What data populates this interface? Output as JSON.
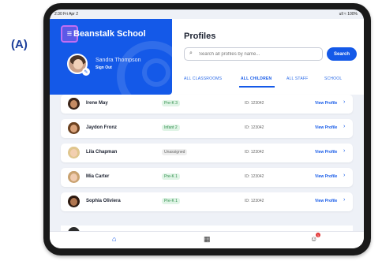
{
  "figure_label": "(A)",
  "status": {
    "time": "2:30  Fri Apr 2",
    "right": "ull ≈ 100%"
  },
  "sidebar": {
    "school_name": "Beanstalk School",
    "user_name": "Sandra Thompson",
    "sign_out": "Sign Out"
  },
  "main": {
    "title": "Profiles",
    "search_placeholder": "Search all profiles by name...",
    "search_button": "Search",
    "tabs": [
      {
        "label": "ALL CLASSROOMS"
      },
      {
        "label": "ALL CHILDREN",
        "active": true
      },
      {
        "label": "ALL STAFF"
      },
      {
        "label": "SCHOOL"
      }
    ]
  },
  "children": [
    {
      "name": "Irene May",
      "class": "Pre-K 3",
      "id": "ID: 123042",
      "action": "View Profile",
      "hair": "#3b2418",
      "skin": "#c58b63"
    },
    {
      "name": "Jaydon Fronz",
      "class": "Infant 2",
      "id": "ID: 123042",
      "action": "View Profile",
      "hair": "#6b4120",
      "skin": "#d9a27a"
    },
    {
      "name": "Lila Chapman",
      "class": "Unassigned",
      "id": "ID: 123042",
      "action": "View Profile",
      "hair": "#e0c68e",
      "skin": "#f3cfb0"
    },
    {
      "name": "Mia Carter",
      "class": "Pre-K 1",
      "id": "ID: 123042",
      "action": "View Profile",
      "hair": "#c9a270",
      "skin": "#f0cbb0"
    },
    {
      "name": "Sophia Oliviera",
      "class": "Pre-K 1",
      "id": "ID: 123042",
      "action": "View Profile",
      "hair": "#2d1a10",
      "skin": "#b07650"
    }
  ],
  "nav": {
    "notification_count": "1"
  },
  "colors": {
    "primary": "#1459e8",
    "menu_highlight": "#c26ef2",
    "badge_green": "#2f8f4c"
  }
}
